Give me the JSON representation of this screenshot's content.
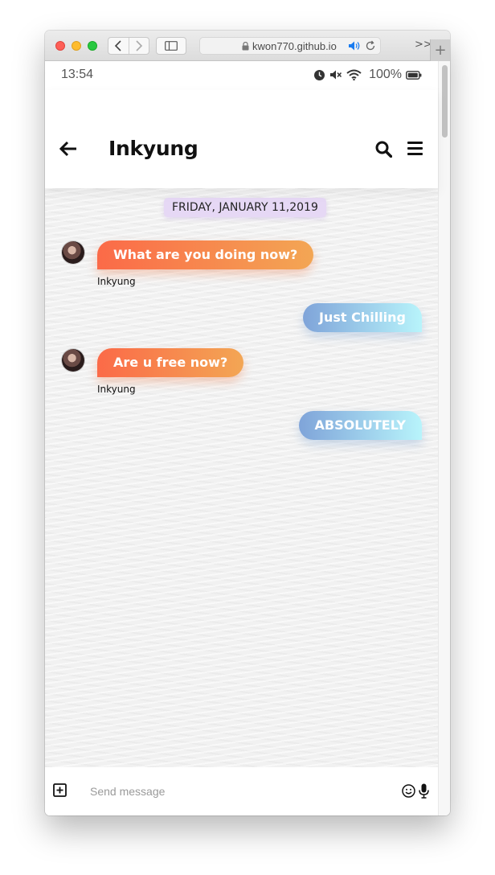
{
  "browser": {
    "url": "kwon770.github.io",
    "icons": [
      "back-chevron-icon",
      "forward-chevron-icon",
      "sidebar-icon",
      "lock-icon",
      "speaker-icon",
      "reload-icon",
      "overflow-chevrons-icon",
      "plus-icon"
    ],
    "overflow_label": ">>",
    "newtab_label": "+"
  },
  "status_bar": {
    "time": "13:54",
    "battery": "100%",
    "icons": [
      "alarm-icon",
      "mute-icon",
      "wifi-icon",
      "battery-icon"
    ]
  },
  "header": {
    "title": "Inkyung",
    "icons": [
      "back-arrow-icon",
      "search-icon",
      "hamburger-menu-icon"
    ]
  },
  "chat": {
    "date": "FRIDAY, JANUARY 11,2019",
    "messages": [
      {
        "direction": "incoming",
        "text": "What are you doing now?",
        "sender": "Inkyung"
      },
      {
        "direction": "outgoing",
        "text": "Just Chilling"
      },
      {
        "direction": "incoming",
        "text": "Are u free now?",
        "sender": "Inkyung"
      },
      {
        "direction": "outgoing",
        "text": "ABSOLUTELY"
      }
    ]
  },
  "composer": {
    "placeholder": "Send message",
    "value": "",
    "icons": [
      "plus-square-icon",
      "emoji-icon",
      "microphone-icon"
    ]
  },
  "colors": {
    "incoming_gradient": [
      "#fb6a48",
      "#f3a654"
    ],
    "outgoing_gradient": [
      "#7fa4d9",
      "#b8f4fb"
    ],
    "date_chip": "#e6d8f5"
  }
}
